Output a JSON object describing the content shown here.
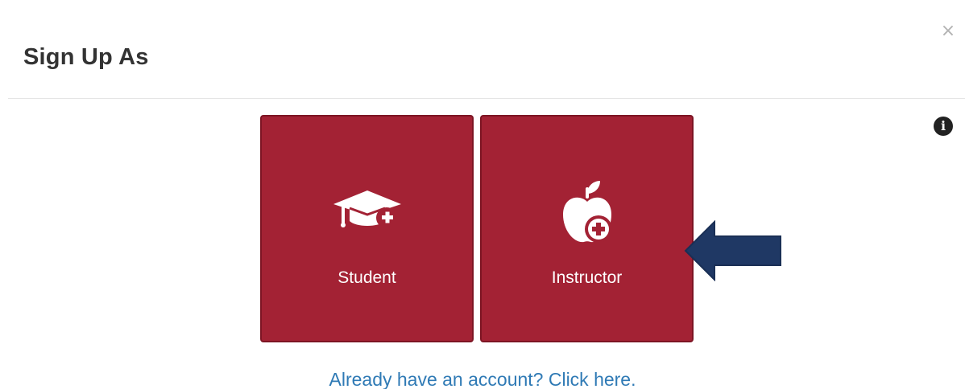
{
  "modal": {
    "title": "Sign Up As",
    "close_label": "×",
    "info_label": "i"
  },
  "roles": [
    {
      "label": "Student",
      "icon": "graduation-cap-plus-icon"
    },
    {
      "label": "Instructor",
      "icon": "apple-plus-icon"
    }
  ],
  "annotation": {
    "icon": "arrow-left-icon",
    "color": "#1f3864"
  },
  "footer": {
    "login_link": "Already have an account? Click here."
  },
  "colors": {
    "card_bg": "#a32234",
    "card_border": "#7d1524",
    "link": "#2f7ab5",
    "title": "#333333"
  }
}
